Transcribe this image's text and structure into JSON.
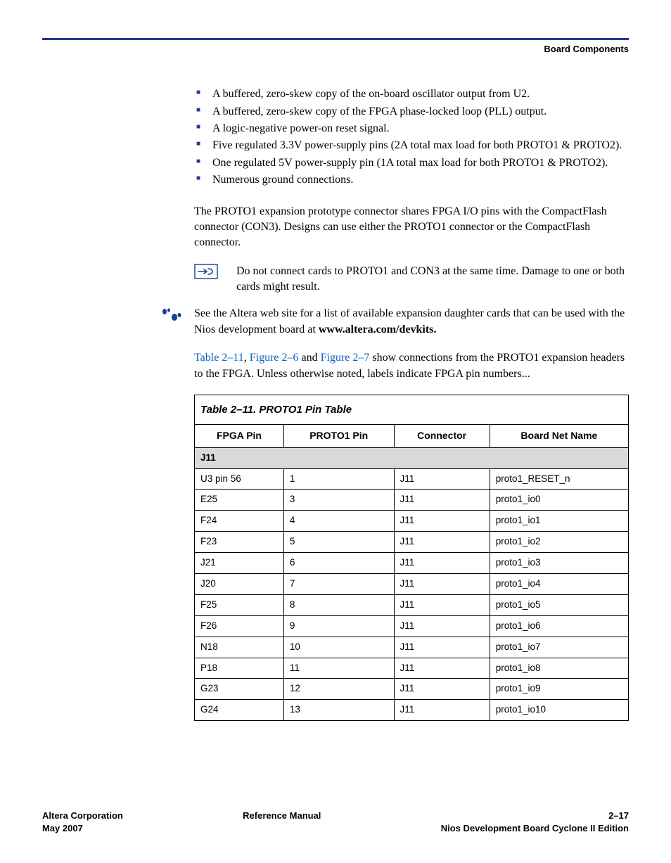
{
  "header": {
    "section": "Board Components"
  },
  "bullets": [
    "A buffered, zero-skew copy of the on-board oscillator output from U2.",
    "A buffered, zero-skew copy of the FPGA phase-locked loop (PLL) output.",
    "A logic-negative power-on reset signal.",
    "Five regulated 3.3V power-supply pins (2A total max load for both PROTO1 & PROTO2).",
    "One regulated 5V power-supply pin (1A total max load for both PROTO1 & PROTO2).",
    "Numerous ground connections."
  ],
  "para1": "The PROTO1 expansion prototype connector shares FPGA I/O pins with the CompactFlash connector (CON3). Designs can use either the PROTO1 connector or the CompactFlash connector.",
  "note1": "Do not connect cards to PROTO1 and CON3 at the same time. Damage to one or both cards might result.",
  "note2_a": "See the Altera web site for a list of available expansion daughter cards that can be used with the Nios development board at ",
  "note2_b": "www.altera.com/devkits.",
  "para2_links": {
    "a": "Table 2–11",
    "b": "Figure 2–6",
    "c": "Figure 2–7"
  },
  "para2_rest": " show connections from the PROTO1 expansion headers to the FPGA. Unless otherwise noted, labels indicate FPGA pin numbers...",
  "para2_sep1": ", ",
  "para2_sep2": " and ",
  "table": {
    "caption": "Table 2–11. PROTO1 Pin Table",
    "headers": [
      "FPGA Pin",
      "PROTO1 Pin",
      "Connector",
      "Board Net Name"
    ],
    "section": "J11",
    "rows": [
      [
        "U3 pin 56",
        "1",
        "J11",
        "proto1_RESET_n"
      ],
      [
        "E25",
        "3",
        "J11",
        "proto1_io0"
      ],
      [
        "F24",
        "4",
        "J11",
        "proto1_io1"
      ],
      [
        "F23",
        "5",
        "J11",
        "proto1_io2"
      ],
      [
        "J21",
        "6",
        "J11",
        "proto1_io3"
      ],
      [
        "J20",
        "7",
        "J11",
        "proto1_io4"
      ],
      [
        "F25",
        "8",
        "J11",
        "proto1_io5"
      ],
      [
        "F26",
        "9",
        "J11",
        "proto1_io6"
      ],
      [
        "N18",
        "10",
        "J11",
        "proto1_io7"
      ],
      [
        "P18",
        "11",
        "J11",
        "proto1_io8"
      ],
      [
        "G23",
        "12",
        "J11",
        "proto1_io9"
      ],
      [
        "G24",
        "13",
        "J11",
        "proto1_io10"
      ]
    ]
  },
  "footer": {
    "left1": "Altera Corporation",
    "left2": "May 2007",
    "center": "Reference Manual",
    "right1": "2–17",
    "right2": "Nios Development Board Cyclone II Edition"
  }
}
